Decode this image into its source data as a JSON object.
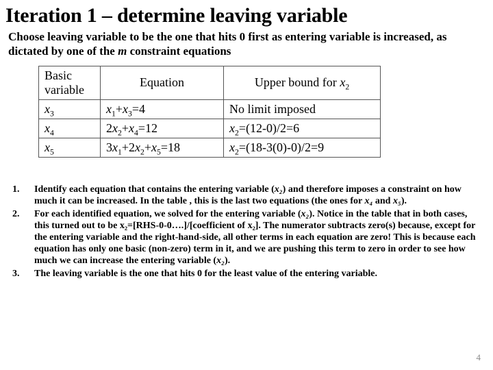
{
  "title": "Iteration 1 – determine leaving variable",
  "subtitle_a": "Choose leaving variable to be the one that hits 0 first as entering variable is increased, as dictated by one of the ",
  "subtitle_m": "m",
  "subtitle_b": " constraint equations",
  "table": {
    "headers": [
      "Basic variable",
      "Equation",
      "Upper bound for x₂"
    ],
    "rows": [
      {
        "bv": "x₃",
        "eq": "x₁+x₃=4",
        "ub": "No limit imposed"
      },
      {
        "bv": "x₄",
        "eq": "2x₂+x₄=12",
        "ub": "x₂=(12-0)/2=6"
      },
      {
        "bv": "x₅",
        "eq": "3x₁+2x₂+x₅=18",
        "ub": "x₂=(18-3(0)-0)/2=9"
      }
    ]
  },
  "notes": {
    "n1_a": "Identify each equation that contains the entering variable (",
    "n1_x2": "x₂",
    "n1_b": ") and therefore imposes a constraint on how much it can be increased. In the table , this is the last two equations (the ones for ",
    "n1_x4": "x₄",
    "n1_c": " and ",
    "n1_x5": "x₅",
    "n1_d": ").",
    "n2_a": "For each identified equation, we solved for the entering variable (",
    "n2_x2": "x₂",
    "n2_b": "). Notice in the table that in both cases, this turned out to be x₂=[RHS-0-0….]/[coefficient of x₂]. The numerator subtracts zero(s) because, except for the entering variable and the right-hand-side, all other terms in each equation are zero! This is because each equation has only one basic (non-zero) term in it, and we are pushing this term to zero in order to see how much we can increase the entering variable (",
    "n2_x2b": "x₂",
    "n2_c": ").",
    "n3": "The leaving variable is the one that hits 0 for the least value of the entering variable."
  },
  "page_number": "4"
}
